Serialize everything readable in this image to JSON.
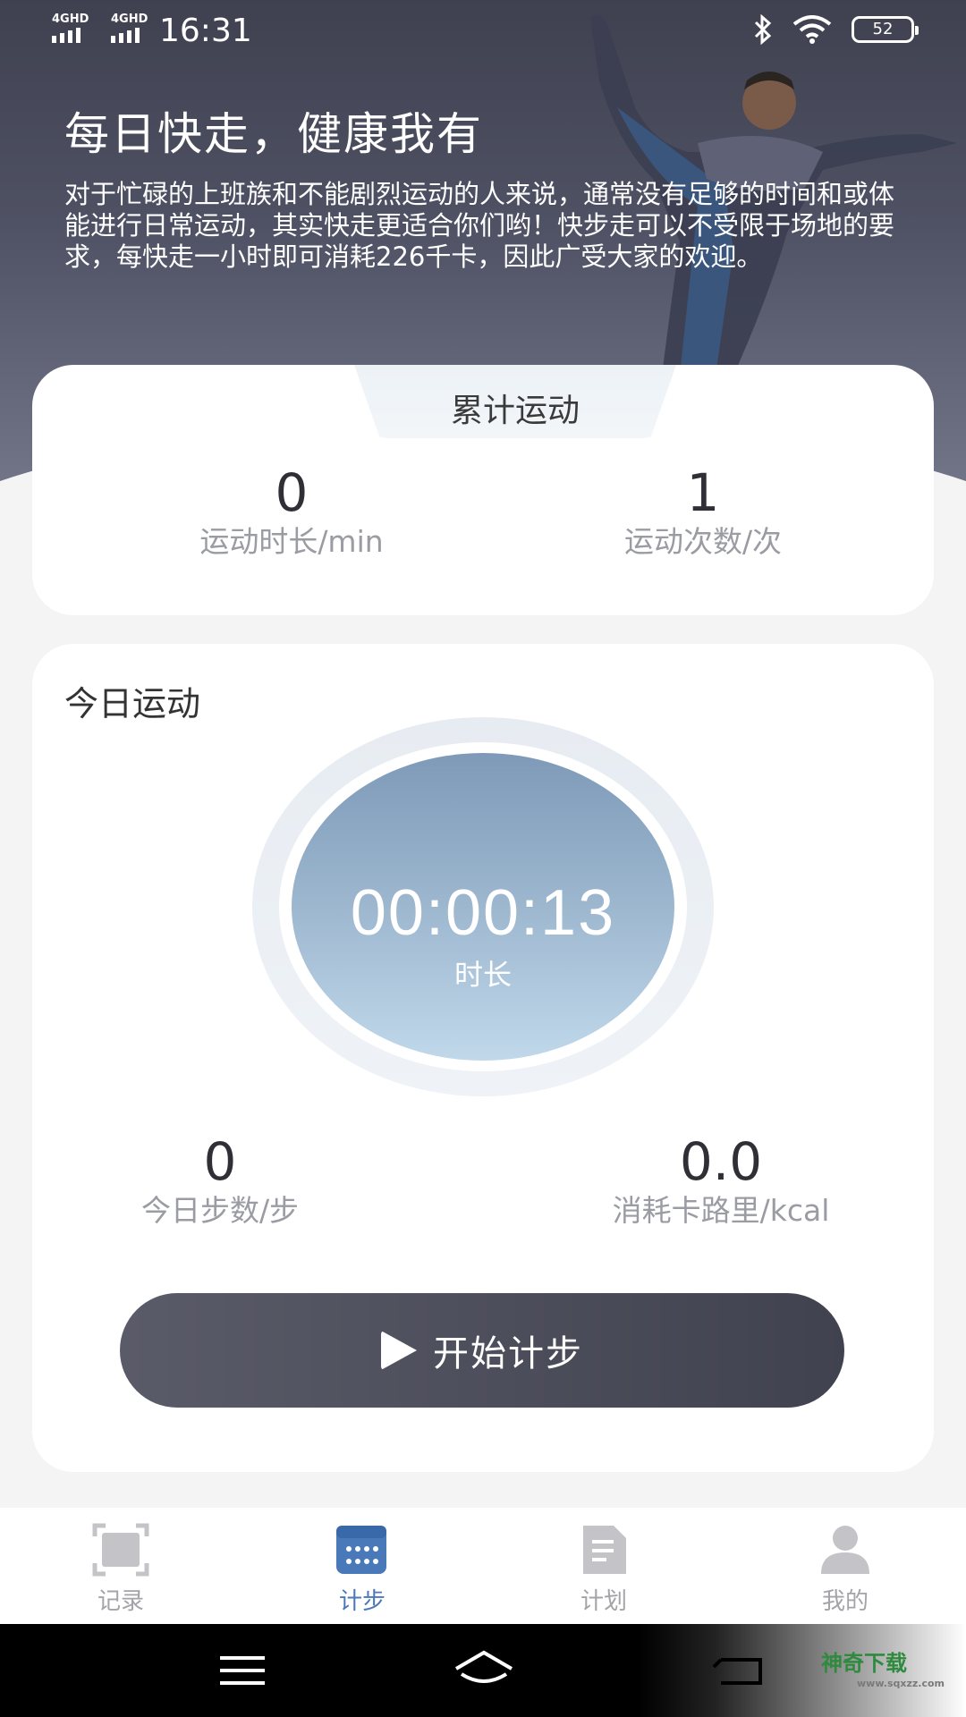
{
  "status_bar": {
    "signal_1": "4GHD",
    "signal_2": "4GHD",
    "time": "16:31",
    "battery": "52"
  },
  "page_title_partial": "计步",
  "hero": {
    "title": "每日快走，健康我有",
    "description": "对于忙碌的上班族和不能剧烈运动的人来说，通常没有足够的时间和或体能进行日常运动，其实快走更适合你们哟！快步走可以不受限于场地的要求，每快走一小时即可消耗226千卡，因此广受大家的欢迎。"
  },
  "total": {
    "tab_label": "累计运动",
    "duration_value": "0",
    "duration_label": "运动时长/min",
    "count_value": "1",
    "count_label": "运动次数/次"
  },
  "today": {
    "title": "今日运动",
    "timer": "00:00:13",
    "timer_label": "时长",
    "steps_value": "0",
    "steps_label": "今日步数/步",
    "calories_value": "0.0",
    "calories_label": "消耗卡路里/kcal",
    "start_label": "开始计步"
  },
  "tabs": [
    {
      "label": "记录",
      "icon": "scan-frame-icon",
      "active": false
    },
    {
      "label": "计步",
      "icon": "calendar-icon",
      "active": true
    },
    {
      "label": "计划",
      "icon": "document-icon",
      "active": false
    },
    {
      "label": "我的",
      "icon": "person-icon",
      "active": false
    }
  ],
  "navbar": {
    "buttons": [
      "menu-icon",
      "home-icon",
      "back-icon"
    ]
  },
  "watermark": {
    "text": "神奇下载",
    "url": "www.sqxzz.com"
  },
  "colors": {
    "accent": "#4a79b9",
    "button_dark": "#45465a",
    "timer_circle": "#9db7cf"
  }
}
